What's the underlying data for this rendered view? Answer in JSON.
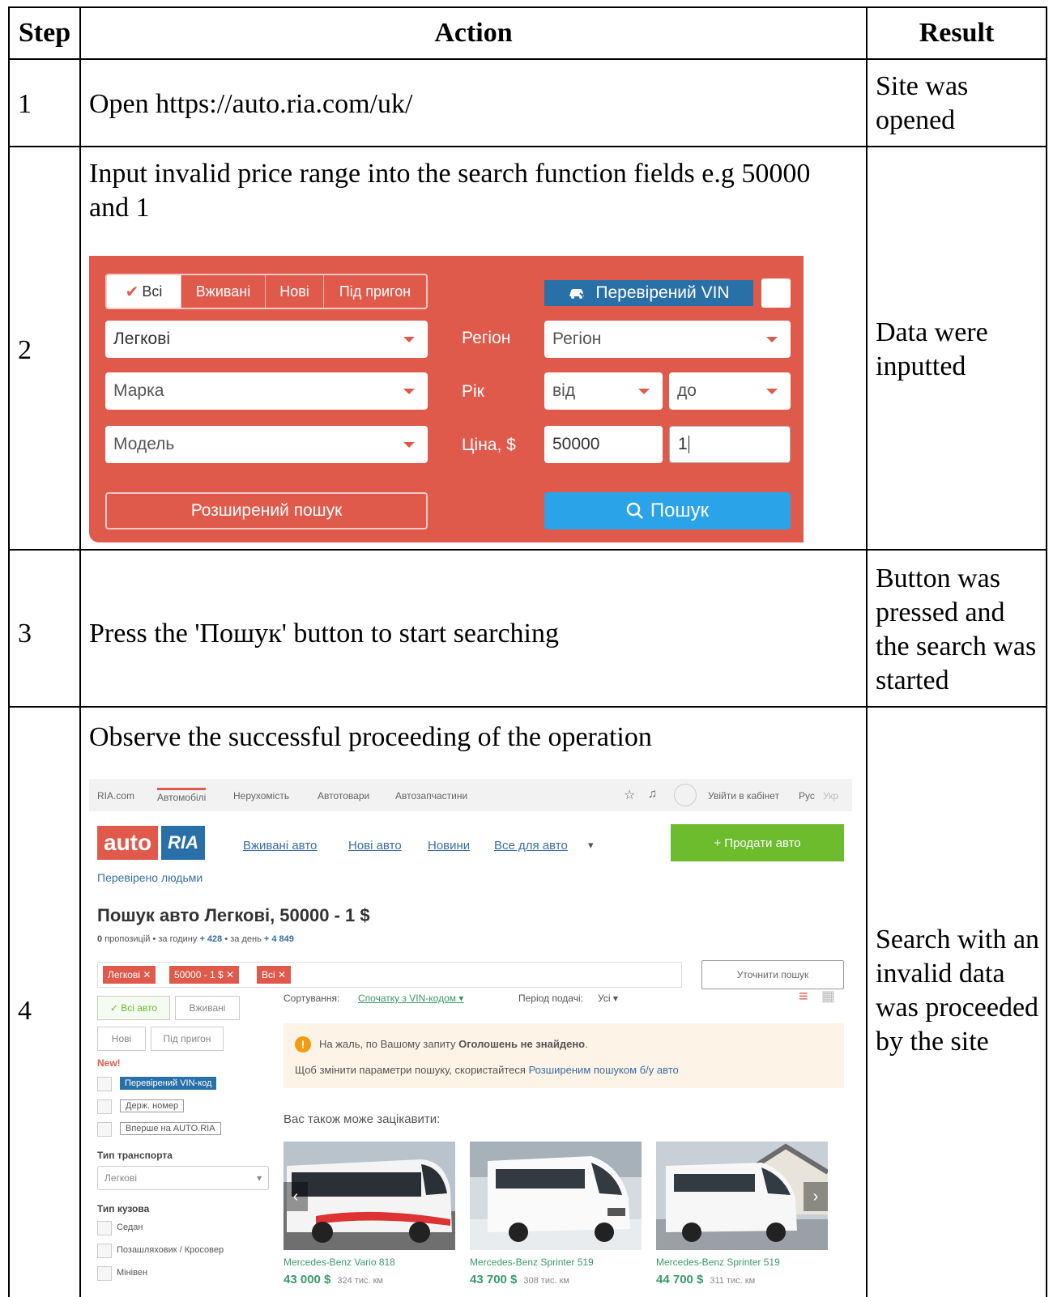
{
  "table": {
    "headers": {
      "step": "Step",
      "action": "Action",
      "result": "Result"
    },
    "rows": [
      {
        "step": "1",
        "action": "Open https://auto.ria.com/uk/",
        "result": "Site was opened"
      },
      {
        "step": "2",
        "action": "Input invalid price range into the search function fields e.g 50000 and 1",
        "result": "Data were inputted"
      },
      {
        "step": "3",
        "action": "Press the 'Пошук' button to start searching",
        "result": "Button was pressed and the search was started"
      },
      {
        "step": "4",
        "action": "Observe the successful proceeding of the operation",
        "result": "Search with an invalid data was proceeded by the site"
      }
    ]
  },
  "search_form": {
    "tabs": [
      "Всі",
      "Вживані",
      "Нові",
      "Під пригон"
    ],
    "active_tab": "Всі",
    "vin_label": "Перевірений VIN",
    "vehicle_type": "Легкові",
    "brand_placeholder": "Марка",
    "model_placeholder": "Модель",
    "region_label": "Регіон",
    "region_placeholder": "Регіон",
    "year_label": "Рік",
    "year_from": "від",
    "year_to": "до",
    "price_label": "Ціна, $",
    "price_from": "50000",
    "price_to": "1",
    "advanced_button": "Розширений пошук",
    "search_button": "Пошук",
    "colors": {
      "form_bg": "#e05a4c",
      "vin_bg": "#2a70a8",
      "search_btn": "#2aa3e8"
    }
  },
  "results_page": {
    "topnav": [
      "RIA.com",
      "Автомобілі",
      "Нерухомість",
      "Автотовари",
      "Автозапчастини"
    ],
    "login": "Увійти в кабінет",
    "lang": "Рус",
    "lang_alt": "Укр",
    "logo_auto": "auto",
    "logo_ria": "RIA",
    "slogan": "Перевірено людьми",
    "mainnav": [
      "Вживані авто",
      "Нові авто",
      "Новини",
      "Все для авто"
    ],
    "sell_button": "+ Продати авто",
    "title": "Пошук авто Легкові, 50000 - 1 $",
    "stats_count": "0",
    "stats": "пропозицій • за годину",
    "stats_hour": "+ 428",
    "stats_day_label": "• за день",
    "stats_day": "+ 4 849",
    "chips": [
      "Легкові ✕",
      "50000 - 1 $ ✕",
      "Всі ✕"
    ],
    "refine_button": "Уточнити пошук",
    "filter_tabs": [
      "✓ Всі авто",
      "Вживані",
      "Нові",
      "Під пригон"
    ],
    "new_label": "New!",
    "vin_filter": "Перевірений VIN-код",
    "plate_filter": "Держ. номер",
    "first_filter": "Вперше на AUTO.RIA",
    "transport_label": "Тип транспорта",
    "transport_value": "Легкові",
    "body_label": "Тип кузова",
    "body_options": [
      "Седан",
      "Позашляховик / Кросовер",
      "Мінівен"
    ],
    "sort_label": "Сортування:",
    "sort_value": "Спочатку з VIN-кодом ▾",
    "period_label": "Період подачі:",
    "period_value": "Усі ▾",
    "alert_line1_pre": "На жаль, по Вашому запиту",
    "alert_line1_bold": "Оголошень не знайдено",
    "alert_line2_pre": "Щоб змінити параметри пошуку, скористайтеся",
    "alert_line2_link": "Розширеним пошуком б/у авто",
    "recommend_title": "Вас також може зацікавити:",
    "cards": [
      {
        "title": "Mercedes-Benz Vario 818",
        "price": "43 000 $",
        "mileage": "324 тис. км"
      },
      {
        "title": "Mercedes-Benz Sprinter 519",
        "price": "43 700 $",
        "mileage": "308 тис. км"
      },
      {
        "title": "Mercedes-Benz Sprinter 519",
        "price": "44 700 $",
        "mileage": "311 тис. км"
      }
    ],
    "colors": {
      "accent": "#e05a4c",
      "brand_blue": "#2a70a8",
      "sell_green": "#6cbc2e",
      "price_green": "#3a9a6a"
    }
  }
}
